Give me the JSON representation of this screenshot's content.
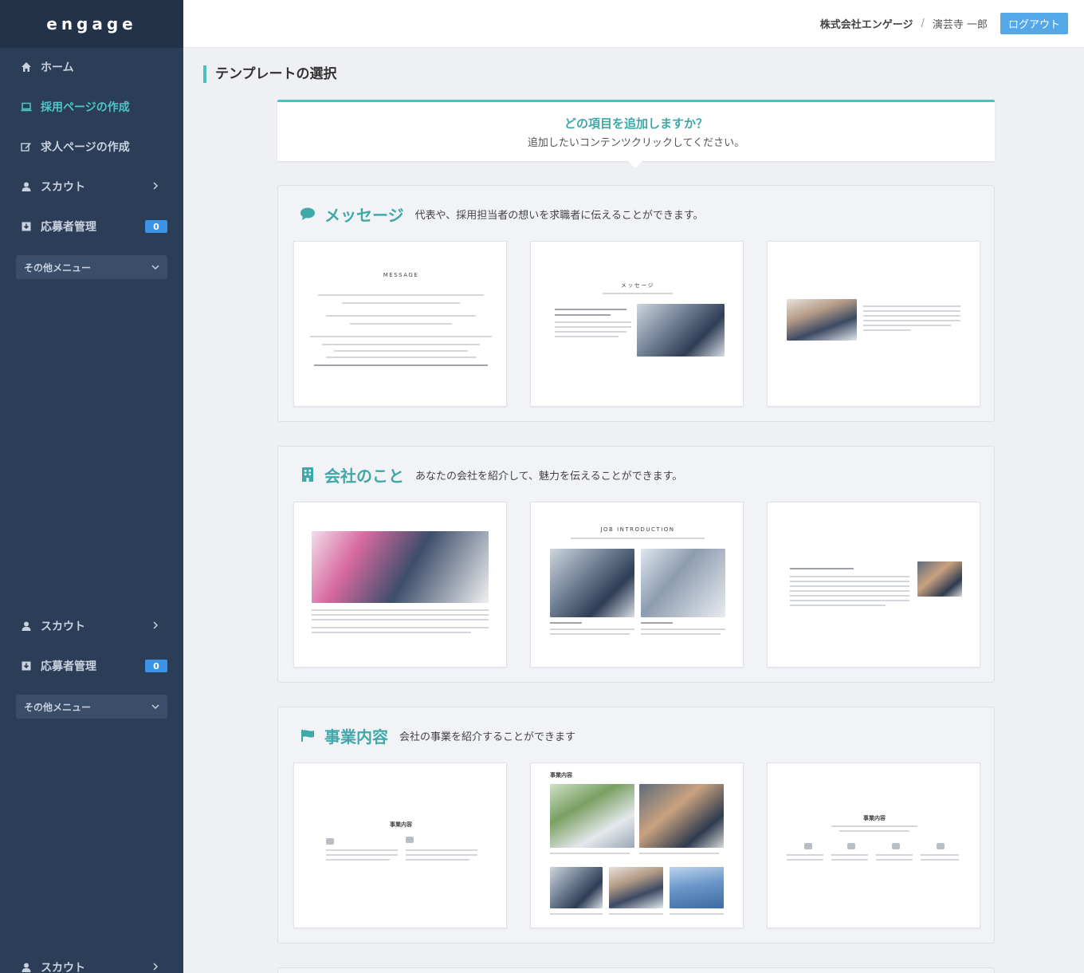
{
  "brand": "engage",
  "header": {
    "company": "株式会社エンゲージ",
    "separator": "/",
    "user": "演芸寺 一郎",
    "logout_label": "ログアウト"
  },
  "sidebar": {
    "items": [
      {
        "label": "ホーム",
        "icon": "home-icon"
      },
      {
        "label": "採用ページの作成",
        "icon": "monitor-icon",
        "active": true
      },
      {
        "label": "求人ページの作成",
        "icon": "edit-icon"
      },
      {
        "label": "スカウト",
        "icon": "user-icon"
      },
      {
        "label": "応募者管理",
        "icon": "download-icon",
        "badge": "0"
      },
      {
        "label": "その他メニュー"
      }
    ],
    "repeat": {
      "scout_label": "スカウト",
      "applicants_label": "応募者管理",
      "applicants_badge": "0",
      "other_label": "その他メニュー",
      "scout_label_2": "スカウト"
    }
  },
  "main": {
    "page_title": "テンプレートの選択",
    "prompt": {
      "title": "どの項目を追加しますか？",
      "subtitle": "追加したいコンテンツクリックしてください。"
    },
    "sections": [
      {
        "icon": "speech-bubble-icon",
        "title": "メッセージ",
        "description": "代表や、採用担当者の想いを求職者に伝えることができます。",
        "card_labels": [
          "MESSAGE",
          "メッセージ",
          ""
        ]
      },
      {
        "icon": "building-icon",
        "title": "会社のこと",
        "description": "あなたの会社を紹介して、魅力を伝えることができます。",
        "card_labels": [
          "",
          "JOB INTRODUCTION",
          ""
        ]
      },
      {
        "icon": "flag-icon",
        "title": "事業内容",
        "description": "会社の事業を紹介することができます",
        "card_labels": [
          "事業内容",
          "事業内容",
          "事業内容"
        ]
      }
    ]
  },
  "colors": {
    "sidebar_bg": "#2b3d57",
    "accent_teal": "#4fc0c0",
    "logout_blue": "#55a8e8",
    "badge_blue": "#3a93e6"
  }
}
